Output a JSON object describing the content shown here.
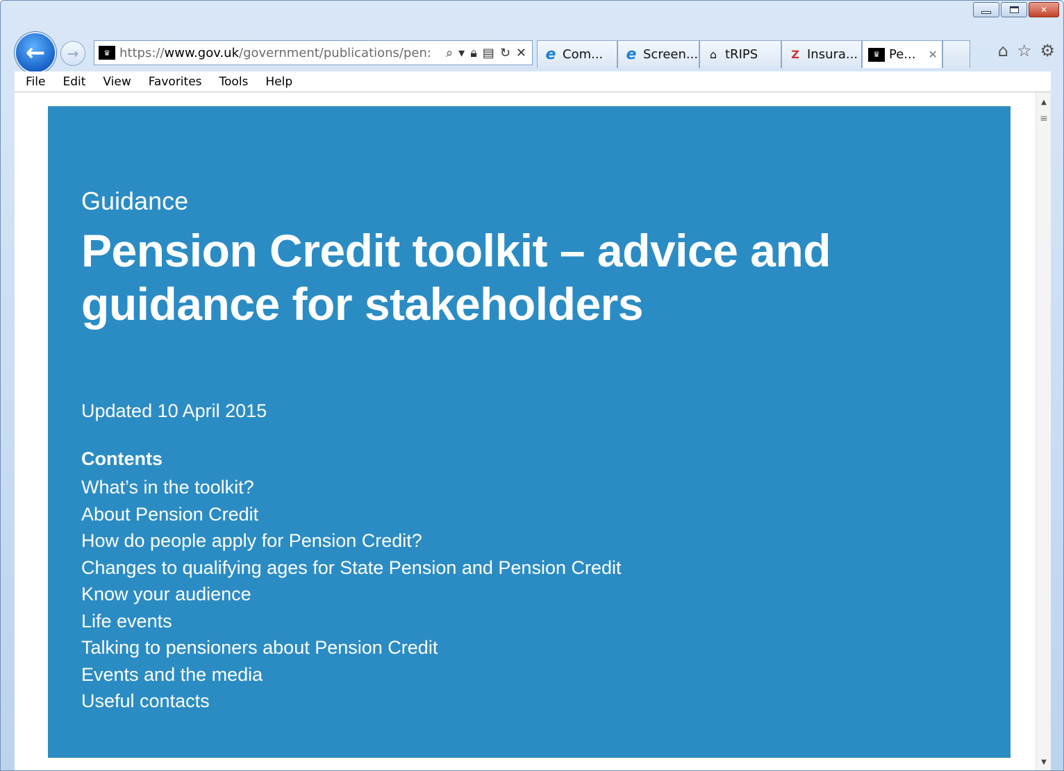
{
  "browser": {
    "address": {
      "scheme": "https://",
      "host": "www.gov.uk",
      "path": "/government/publications/pen:"
    },
    "tabs": [
      {
        "label": "Com...",
        "icon": "ie-icon"
      },
      {
        "label": "Screen...",
        "icon": "ie-icon"
      },
      {
        "label": "tRIPS",
        "icon": "trips-icon"
      },
      {
        "label": "Insura...",
        "icon": "insurance-icon"
      },
      {
        "label": "Pe...",
        "icon": "govuk-crown-icon",
        "active": true
      }
    ],
    "menu": [
      "File",
      "Edit",
      "View",
      "Favorites",
      "Tools",
      "Help"
    ]
  },
  "page": {
    "label": "Guidance",
    "title": "Pension Credit toolkit – advice and guidance for stakeholders",
    "updated": "Updated 10 April 2015",
    "contents_title": "Contents",
    "contents": [
      "What’s in the toolkit?",
      "About Pension Credit",
      "How do people apply for Pension Credit?",
      "Changes to qualifying ages for State Pension and Pension Credit",
      "Know your audience",
      "Life events",
      "Talking to pensioners about Pension Credit",
      "Events and the media",
      "Useful contacts"
    ]
  },
  "colors": {
    "hero_background": "#2b8cc4",
    "hero_text": "#ffffff"
  }
}
